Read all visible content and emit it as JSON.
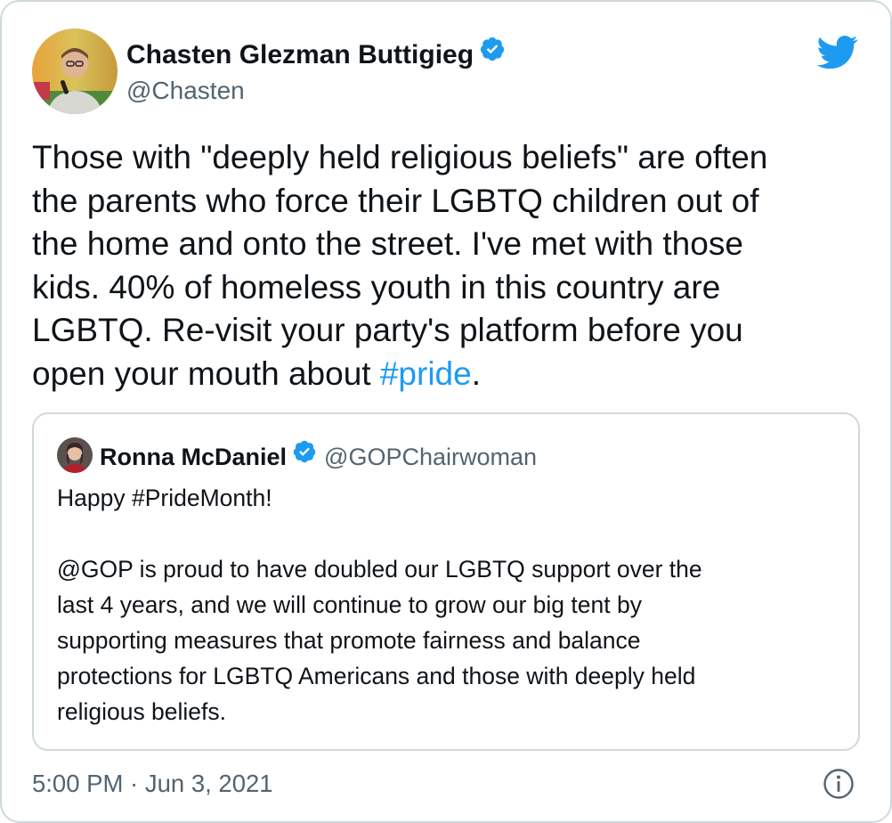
{
  "tweet": {
    "author_name": "Chasten Glezman Buttigieg",
    "author_handle": "@Chasten",
    "verified": true,
    "text_lines": [
      "Those with \"deeply held religious beliefs\" are often",
      "the parents who force their LGBTQ children out of",
      "the home and onto the street. I've met with those",
      "kids. 40% of homeless youth in this country are",
      "LGBTQ. Re-visit your party's platform before you"
    ],
    "text_last_prefix": "open your mouth about ",
    "hashtag": "#pride",
    "text_last_suffix": ".",
    "timestamp": "5:00 PM · Jun 3, 2021"
  },
  "quoted_tweet": {
    "author_name": "Ronna McDaniel",
    "author_handle": "@GOPChairwoman",
    "verified": true,
    "text": "Happy #PrideMonth!\n\n@GOP is proud to have doubled our LGBTQ support over the\nlast 4 years, and we will continue to grow our big tent by\nsupporting measures that promote fairness and balance\nprotections for LGBTQ Americans and those with deeply held\nreligious beliefs."
  },
  "icons": {
    "brand": "twitter-bird-icon",
    "verified": "verified-badge-icon",
    "info": "info-icon"
  },
  "colors": {
    "brand_blue": "#1d9bf0",
    "secondary_text": "#536471",
    "border": "#cfd9de"
  }
}
